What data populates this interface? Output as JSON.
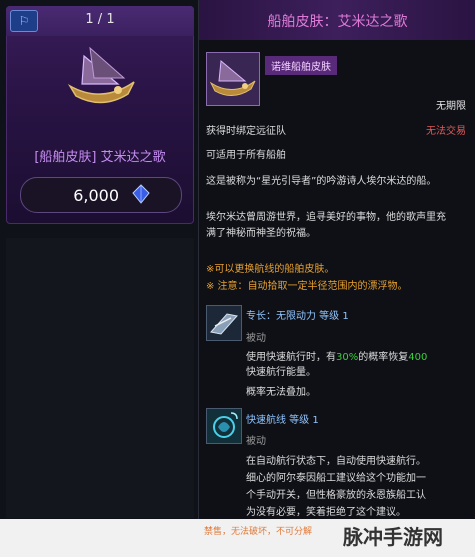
{
  "card": {
    "badge": "⚐",
    "count": "1 / 1",
    "title": "[船舶皮肤] 艾米达之歌",
    "price": "6,000"
  },
  "tooltip": {
    "header": "船舶皮肤：艾米达之歌",
    "item_name": "诺维船舶皮肤",
    "limit": "无期限",
    "bind": "获得时绑定远征队",
    "trade": "无法交易",
    "applicable": "可适用于所有船舶",
    "desc1": "这是被称为“星光引导者”的吟游诗人埃尔米达的船。",
    "desc2": "埃尔米达曾周游世界，追寻美好的事物，他的歌声里充",
    "desc3": "满了神秘而神圣的祝福。",
    "note1": "※可以更换航线的船舶皮肤。",
    "note2_prefix": "※ 注意：",
    "note2": "自动拾取一定半径范围内的漂浮物。",
    "skill1": {
      "name": "专长：无限动力 等级 1",
      "type": "被动",
      "line1_a": "使用快速航行时，有",
      "line1_pct": "30%",
      "line1_b": "的概率恢复",
      "line1_num": "400",
      "line2": "快速航行能量。",
      "line3": "概率无法叠加。"
    },
    "skill2": {
      "name": "快速航线 等级 1",
      "type": "被动",
      "line1": "在自动航行状态下，自动使用快速航行。",
      "line2": "细心的阿尔泰因船工建议给这个功能加一",
      "line3": "个手动开关，但性格豪放的永恩族船工认",
      "line4": "为没有必要，笑着拒绝了这个建议。"
    }
  },
  "footer": {
    "note": "禁售，无法破坏，不可分解",
    "watermark": "脉冲手游网"
  }
}
